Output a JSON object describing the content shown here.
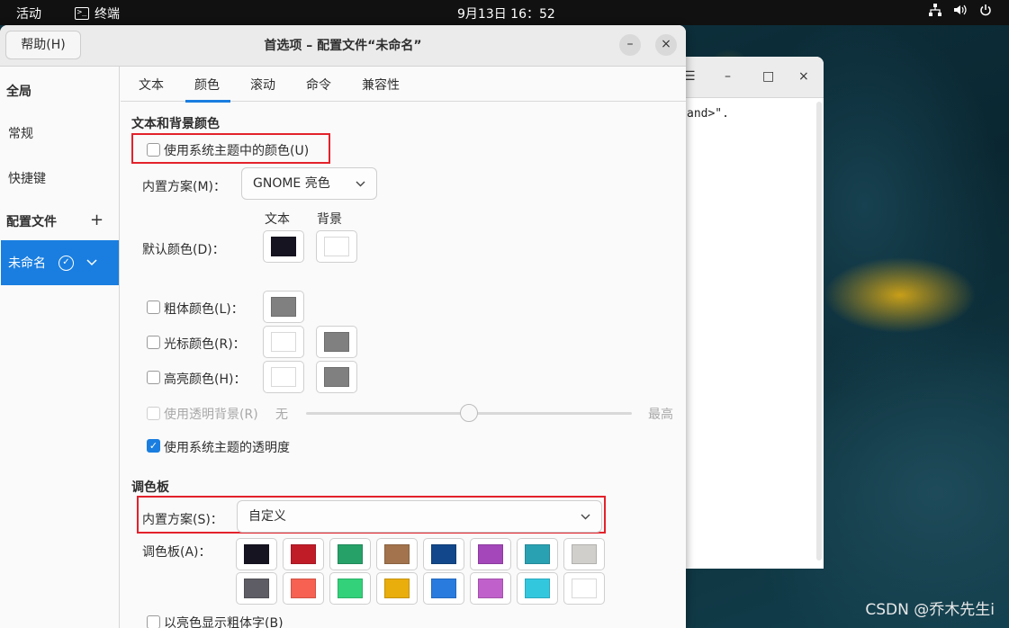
{
  "topbar": {
    "activities": "活动",
    "app_name": "终端",
    "clock": "9月13日  16：52",
    "tray_icons": [
      "network-icon",
      "volume-icon",
      "power-icon"
    ]
  },
  "bg_terminal": {
    "menu_glyph": "☰",
    "minimize": "–",
    "maximize": "□",
    "close": "×",
    "text": "and>\"."
  },
  "dialog": {
    "help_label": "帮助(H)",
    "title": "首选项 – 配置文件“未命名”",
    "minimize_glyph": "–",
    "close_glyph": "×"
  },
  "sidebar": {
    "global_heading": "全局",
    "general": "常规",
    "shortcuts": "快捷键",
    "profiles_heading": "配置文件",
    "add_glyph": "+",
    "selected_profile": "未命名"
  },
  "tabs": [
    "文本",
    "颜色",
    "滚动",
    "命令",
    "兼容性"
  ],
  "active_tab": "颜色",
  "colors": {
    "section_title": "文本和背景颜色",
    "use_system_theme": "使用系统主题中的颜色(U)",
    "use_system_theme_checked": false,
    "builtin_scheme_label": "内置方案(M)：",
    "builtin_scheme_value": "GNOME 亮色",
    "col_text": "文本",
    "col_bg": "背景",
    "default_color_label": "默认颜色(D)：",
    "default_text_color": "#171421",
    "default_bg_color": "#ffffff",
    "bold_color_label": "粗体颜色(L)：",
    "bold_color": "#808080",
    "cursor_color_label": "光标颜色(R)：",
    "cursor_text_color": "#ffffff",
    "cursor_bg_color": "#808080",
    "highlight_color_label": "高亮颜色(H)：",
    "highlight_text_color": "#ffffff",
    "highlight_bg_color": "#808080",
    "transparent_bg_label": "使用透明背景(R)",
    "slider_min": "无",
    "slider_max": "最高",
    "transparency_level": 0.5,
    "use_system_transparency": "使用系统主题的透明度",
    "use_system_transparency_checked": true
  },
  "palette": {
    "section_title": "调色板",
    "builtin_scheme_label": "内置方案(S)：",
    "builtin_scheme_value": "自定义",
    "palette_label": "调色板(A)：",
    "row1": [
      "#171421",
      "#c01c28",
      "#26a269",
      "#a2734c",
      "#12488b",
      "#a347ba",
      "#2aa1b3",
      "#d0cfcc"
    ],
    "row2": [
      "#5e5c64",
      "#f66151",
      "#33d17a",
      "#e9ad0c",
      "#2a7bde",
      "#c061cb",
      "#33c7de",
      "#ffffff"
    ],
    "bold_bright_label": "以亮色显示粗体字(B)"
  },
  "watermark": "CSDN @乔木先生i"
}
